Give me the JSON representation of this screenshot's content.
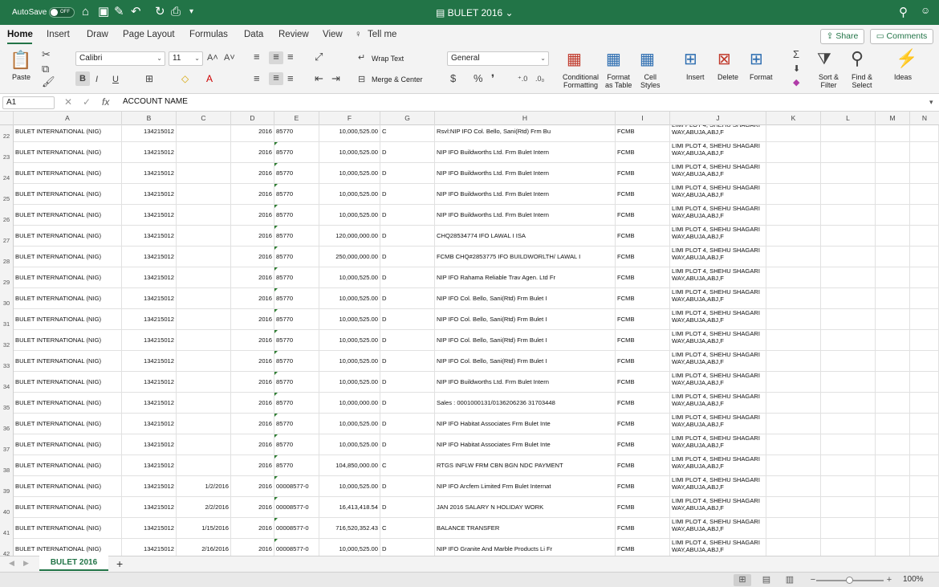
{
  "titlebar": {
    "autosave": "AutoSave",
    "toggle": "OFF",
    "title": "BULET 2016"
  },
  "tabs": {
    "home": "Home",
    "insert": "Insert",
    "draw": "Draw",
    "page_layout": "Page Layout",
    "formulas": "Formulas",
    "data": "Data",
    "review": "Review",
    "view": "View",
    "tell_me": "Tell me",
    "share": "Share",
    "comments": "Comments"
  },
  "ribbon": {
    "paste": "Paste",
    "font": "Calibri",
    "size": "11",
    "wrap_text": "Wrap Text",
    "merge_center": "Merge & Center",
    "number_format": "General",
    "cond_format": "Conditional",
    "cond_format2": "Formatting",
    "format_table": "Format",
    "format_table2": "as Table",
    "cell_styles": "Cell",
    "cell_styles2": "Styles",
    "insert": "Insert",
    "delete": "Delete",
    "format": "Format",
    "sort_filter": "Sort &",
    "sort_filter2": "Filter",
    "find_select": "Find &",
    "find_select2": "Select",
    "ideas": "Ideas"
  },
  "formula_bar": {
    "name_box": "A1",
    "content": "ACCOUNT NAME"
  },
  "columns": [
    "A",
    "B",
    "C",
    "D",
    "E",
    "F",
    "G",
    "H",
    "I",
    "J",
    "K",
    "L",
    "M",
    "N"
  ],
  "rows": [
    {
      "n": "22",
      "a": "BULET INTERNATIONAL (NIG)",
      "b": "134215012",
      "c": "",
      "d": "2016",
      "e": "85770",
      "f": "10,000,525.00",
      "g": "C",
      "h": "Rsvl:NIP IFO Col. Bello, Sani(Rtd) Frm Bu",
      "i": "FCMB",
      "j": "LIMI    PLOT 4, SHEHU SHAGARI WAY,ABUJA,ABJ,F"
    },
    {
      "n": "23",
      "a": "BULET INTERNATIONAL (NIG)",
      "b": "134215012",
      "c": "",
      "d": "2016",
      "e": "85770",
      "f": "10,000,525.00",
      "g": "D",
      "h": "NIP IFO Buildworths Ltd. Frm Bulet Intern",
      "i": "FCMB",
      "j": "LIMI    PLOT 4, SHEHU SHAGARI WAY,ABUJA,ABJ,F"
    },
    {
      "n": "24",
      "a": "BULET INTERNATIONAL (NIG)",
      "b": "134215012",
      "c": "",
      "d": "2016",
      "e": "85770",
      "f": "10,000,525.00",
      "g": "D",
      "h": "NIP IFO Buildworths Ltd. Frm Bulet Intern",
      "i": "FCMB",
      "j": "LIMI    PLOT 4, SHEHU SHAGARI WAY,ABUJA,ABJ,F"
    },
    {
      "n": "25",
      "a": "BULET INTERNATIONAL (NIG)",
      "b": "134215012",
      "c": "",
      "d": "2016",
      "e": "85770",
      "f": "10,000,525.00",
      "g": "D",
      "h": "NIP IFO Buildworths Ltd. Frm Bulet Intern",
      "i": "FCMB",
      "j": "LIMI    PLOT 4, SHEHU SHAGARI WAY,ABUJA,ABJ,F"
    },
    {
      "n": "26",
      "a": "BULET INTERNATIONAL (NIG)",
      "b": "134215012",
      "c": "",
      "d": "2016",
      "e": "85770",
      "f": "10,000,525.00",
      "g": "D",
      "h": "NIP IFO Buildworths Ltd. Frm Bulet Intern",
      "i": "FCMB",
      "j": "LIMI    PLOT 4, SHEHU SHAGARI WAY,ABUJA,ABJ,F"
    },
    {
      "n": "27",
      "a": "BULET INTERNATIONAL (NIG)",
      "b": "134215012",
      "c": "",
      "d": "2016",
      "e": "85770",
      "f": "120,000,000.00",
      "g": "D",
      "h": "CHQ28534774 IFO LAWAL I ISA",
      "i": "FCMB",
      "j": "LIMI    PLOT 4, SHEHU SHAGARI WAY,ABUJA,ABJ,F"
    },
    {
      "n": "28",
      "a": "BULET INTERNATIONAL (NIG)",
      "b": "134215012",
      "c": "",
      "d": "2016",
      "e": "85770",
      "f": "250,000,000.00",
      "g": "D",
      "h": "FCMB CHQ#2853775 IFO BUILDWORLTH/ LAWAL I",
      "i": "FCMB",
      "j": "LIMI    PLOT 4, SHEHU SHAGARI WAY,ABUJA,ABJ,F"
    },
    {
      "n": "29",
      "a": "BULET INTERNATIONAL (NIG)",
      "b": "134215012",
      "c": "",
      "d": "2016",
      "e": "85770",
      "f": "10,000,525.00",
      "g": "D",
      "h": "NIP IFO Rahama Reliable Trav Agen. Ltd Fr",
      "i": "FCMB",
      "j": "LIMI    PLOT 4, SHEHU SHAGARI WAY,ABUJA,ABJ,F"
    },
    {
      "n": "30",
      "a": "BULET INTERNATIONAL (NIG)",
      "b": "134215012",
      "c": "",
      "d": "2016",
      "e": "85770",
      "f": "10,000,525.00",
      "g": "D",
      "h": "NIP IFO Col. Bello, Sani(Rtd) Frm Bulet I",
      "i": "FCMB",
      "j": "LIMI    PLOT 4, SHEHU SHAGARI WAY,ABUJA,ABJ,F"
    },
    {
      "n": "31",
      "a": "BULET INTERNATIONAL (NIG)",
      "b": "134215012",
      "c": "",
      "d": "2016",
      "e": "85770",
      "f": "10,000,525.00",
      "g": "D",
      "h": "NIP IFO Col. Bello, Sani(Rtd) Frm Bulet I",
      "i": "FCMB",
      "j": "LIMI    PLOT 4, SHEHU SHAGARI WAY,ABUJA,ABJ,F"
    },
    {
      "n": "32",
      "a": "BULET INTERNATIONAL (NIG)",
      "b": "134215012",
      "c": "",
      "d": "2016",
      "e": "85770",
      "f": "10,000,525.00",
      "g": "D",
      "h": "NIP IFO Col. Bello, Sani(Rtd) Frm Bulet I",
      "i": "FCMB",
      "j": "LIMI    PLOT 4, SHEHU SHAGARI WAY,ABUJA,ABJ,F"
    },
    {
      "n": "33",
      "a": "BULET INTERNATIONAL (NIG)",
      "b": "134215012",
      "c": "",
      "d": "2016",
      "e": "85770",
      "f": "10,000,525.00",
      "g": "D",
      "h": "NIP IFO Col. Bello, Sani(Rtd) Frm Bulet I",
      "i": "FCMB",
      "j": "LIMI    PLOT 4, SHEHU SHAGARI WAY,ABUJA,ABJ,F"
    },
    {
      "n": "34",
      "a": "BULET INTERNATIONAL (NIG)",
      "b": "134215012",
      "c": "",
      "d": "2016",
      "e": "85770",
      "f": "10,000,525.00",
      "g": "D",
      "h": "NIP IFO Buildworths Ltd. Frm Bulet Intern",
      "i": "FCMB",
      "j": "LIMI    PLOT 4, SHEHU SHAGARI WAY,ABUJA,ABJ,F"
    },
    {
      "n": "35",
      "a": "BULET INTERNATIONAL (NIG)",
      "b": "134215012",
      "c": "",
      "d": "2016",
      "e": "85770",
      "f": "10,000,000.00",
      "g": "D",
      "h": "Sales : 0001000131/0136206236  31703448",
      "i": "FCMB",
      "j": "LIMI    PLOT 4, SHEHU SHAGARI WAY,ABUJA,ABJ,F"
    },
    {
      "n": "36",
      "a": "BULET INTERNATIONAL (NIG)",
      "b": "134215012",
      "c": "",
      "d": "2016",
      "e": "85770",
      "f": "10,000,525.00",
      "g": "D",
      "h": "NIP IFO Habitat Associates Frm Bulet Inte",
      "i": "FCMB",
      "j": "LIMI    PLOT 4, SHEHU SHAGARI WAY,ABUJA,ABJ,F"
    },
    {
      "n": "37",
      "a": "BULET INTERNATIONAL (NIG)",
      "b": "134215012",
      "c": "",
      "d": "2016",
      "e": "85770",
      "f": "10,000,525.00",
      "g": "D",
      "h": "NIP IFO Habitat Associates Frm Bulet Inte",
      "i": "FCMB",
      "j": "LIMI    PLOT 4, SHEHU SHAGARI WAY,ABUJA,ABJ,F"
    },
    {
      "n": "38",
      "a": "BULET INTERNATIONAL (NIG)",
      "b": "134215012",
      "c": "",
      "d": "2016",
      "e": "85770",
      "f": "104,850,000.00",
      "g": "C",
      "h": "RTGS INFLW FRM CBN BGN NDC PAYMENT",
      "i": "FCMB",
      "j": "LIMI    PLOT 4, SHEHU SHAGARI WAY,ABUJA,ABJ,F"
    },
    {
      "n": "39",
      "a": "BULET INTERNATIONAL (NIG)",
      "b": "134215012",
      "c": "1/2/2016",
      "d": "2016",
      "e": "00008577-0",
      "f": "10,000,525.00",
      "g": "D",
      "h": "NIP IFO Arcfem Limited Frm Bulet Internat",
      "i": "FCMB",
      "j": "LIMI    PLOT 4, SHEHU SHAGARI WAY,ABUJA,ABJ,F"
    },
    {
      "n": "40",
      "a": "BULET INTERNATIONAL (NIG)",
      "b": "134215012",
      "c": "2/2/2016",
      "d": "2016",
      "e": "00008577-0",
      "f": "16,413,418.54",
      "g": "D",
      "h": "JAN 2016 SALARY N HOLIDAY WORK",
      "i": "FCMB",
      "j": "LIMI    PLOT 4, SHEHU SHAGARI WAY,ABUJA,ABJ,F"
    },
    {
      "n": "41",
      "a": "BULET INTERNATIONAL (NIG)",
      "b": "134215012",
      "c": "1/15/2016",
      "d": "2016",
      "e": "00008577-0",
      "f": "716,520,352.43",
      "g": "C",
      "h": "BALANCE TRANSFER",
      "i": "FCMB",
      "j": "LIMI    PLOT 4, SHEHU SHAGARI WAY,ABUJA,ABJ,F"
    },
    {
      "n": "42",
      "a": "BULET INTERNATIONAL (NIG)",
      "b": "134215012",
      "c": "2/16/2016",
      "d": "2016",
      "e": "00008577-0",
      "f": "10,000,525.00",
      "g": "D",
      "h": "NIP IFO Granite And Marble Products Li Fr",
      "i": "FCMB",
      "j": "LIMI    PLOT 4, SHEHU SHAGARI WAY,ABUJA,ABJ,F"
    }
  ],
  "sheet_tab": "BULET 2016",
  "status": {
    "zoom": "100%"
  }
}
